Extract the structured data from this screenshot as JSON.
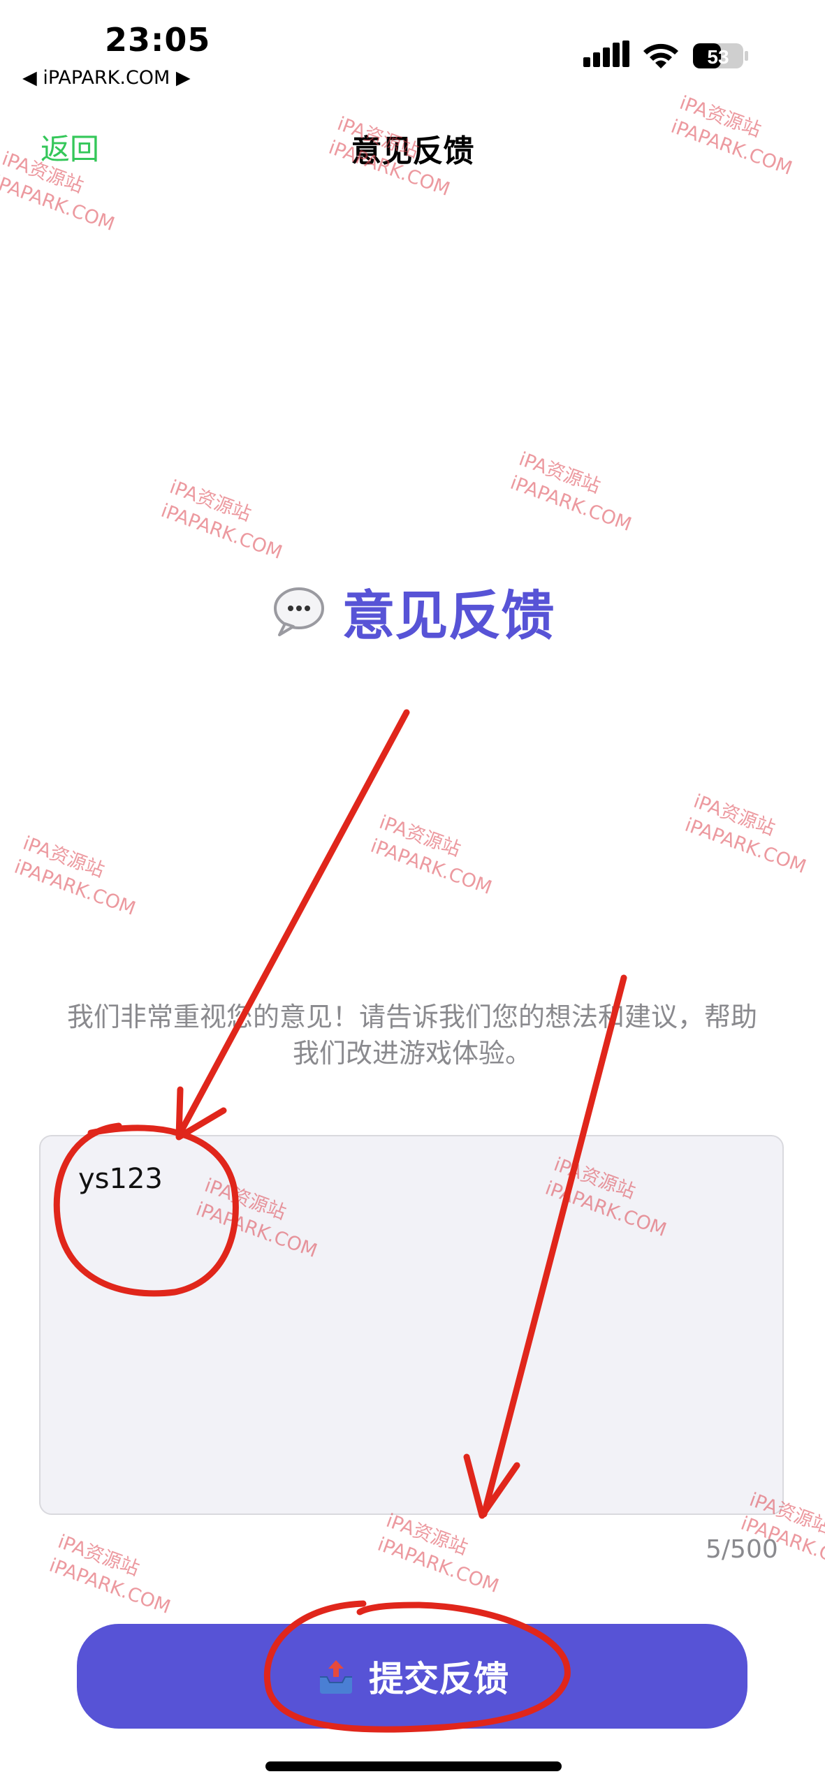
{
  "status_bar": {
    "time": "23:05",
    "carrier": "◀ iPAPARK.COM ▶",
    "battery": "53"
  },
  "nav": {
    "back_label": "返回",
    "title": "意见反馈"
  },
  "main": {
    "heading": "意见反馈",
    "heading_icon": "speech-bubble-icon",
    "description": "我们非常重视您的意见！请告诉我们您的想法和建议，帮助我们改进游戏体验。",
    "feedback_input": {
      "value": "ys123"
    },
    "char_counter": "5/500",
    "submit_label": "提交反馈",
    "submit_icon": "outbox-tray-icon"
  },
  "watermarks": [
    {
      "line1": "iPA资源站",
      "line2": "iPAPARK.COM"
    }
  ],
  "colors": {
    "accent": "#5753d6",
    "back": "#34c759",
    "annotation": "#e0261b"
  }
}
